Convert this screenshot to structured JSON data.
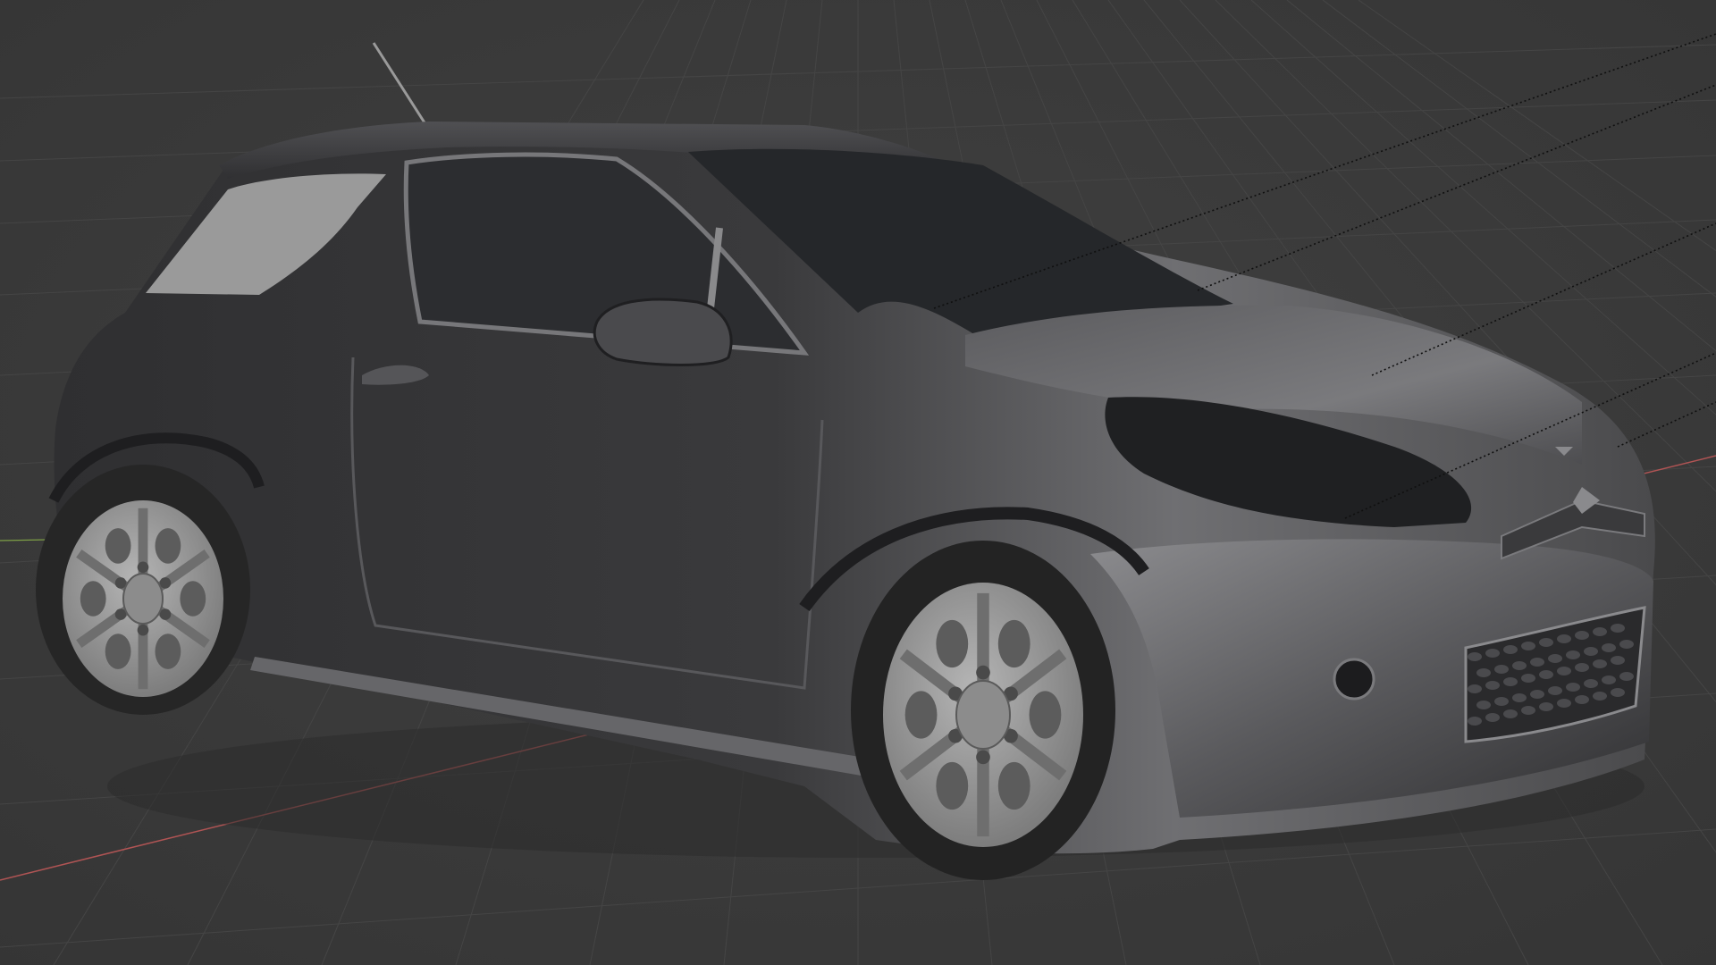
{
  "viewport": {
    "view_mode": "solid",
    "shading": "studio",
    "background_color": "#3a3a3a",
    "grid_color": "#454545",
    "x_axis_color": "#c25c5c",
    "y_axis_color": "#7ea046",
    "relationship_line_color": "#101010"
  },
  "scene": {
    "object": "car-model",
    "body_color": "#3c3c3e",
    "glass_color": "#2a2b2e",
    "rear_glass_color": "#9a9a9a",
    "wheel_color": "#9c9c9c",
    "tire_color": "#262626"
  }
}
